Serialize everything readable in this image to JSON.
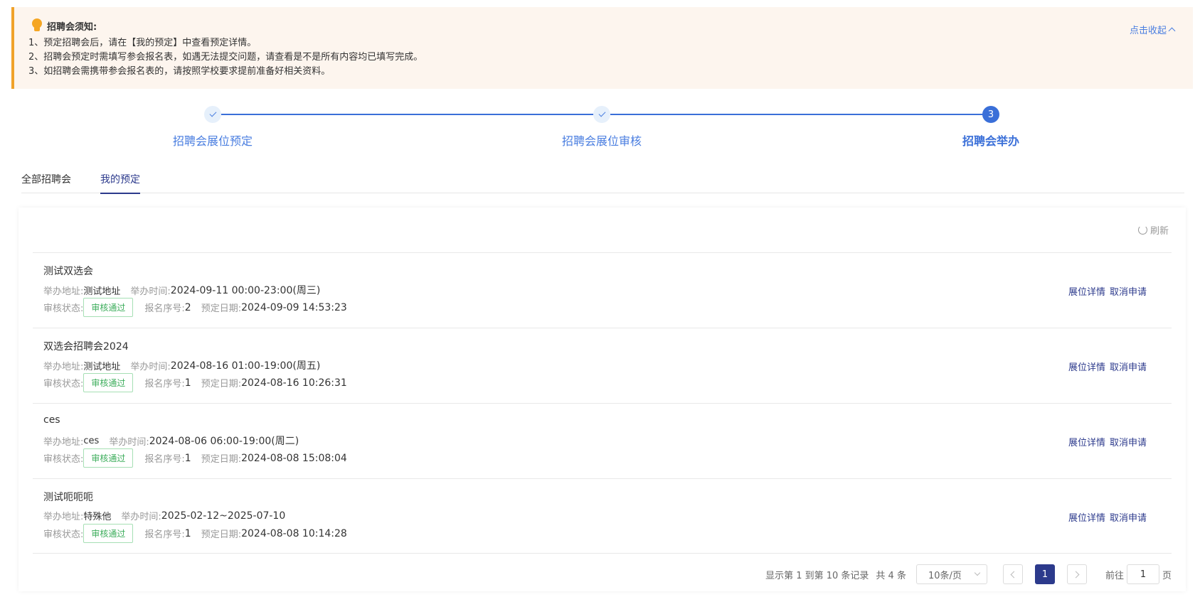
{
  "notice": {
    "title": "招聘会须知:",
    "lines": [
      "1、预定招聘会后，请在【我的预定】中查看预定详情。",
      "2、招聘会预定时需填写参会报名表，如遇无法提交问题，请查看是不是所有内容均已填写完成。",
      "3、如招聘会需携带参会报名表的，请按照学校要求提前准备好相关资料。"
    ],
    "collapse_label": "点击收起"
  },
  "steps": [
    {
      "label": "招聘会展位预定",
      "status": "done"
    },
    {
      "label": "招聘会展位审核",
      "status": "done"
    },
    {
      "label": "招聘会举办",
      "status": "active",
      "number": "3"
    }
  ],
  "tabs": [
    {
      "label": "全部招聘会",
      "active": false
    },
    {
      "label": "我的预定",
      "active": true
    }
  ],
  "refresh_label": "刷新",
  "labels": {
    "address": "举办地址:",
    "time": "举办时间:",
    "status": "审核状态:",
    "serial": "报名序号:",
    "booked": "预定日期:"
  },
  "items": [
    {
      "title": "测试双选会",
      "address": "测试地址",
      "time": "2024-09-11 00:00-23:00(周三)",
      "status": "审核通过",
      "serial": "2",
      "booked": "2024-09-09 14:53:23",
      "detail": "展位详情",
      "cancel": "取消申请"
    },
    {
      "title": "双选会招聘会2024",
      "address": "测试地址",
      "time": "2024-08-16 01:00-19:00(周五)",
      "status": "审核通过",
      "serial": "1",
      "booked": "2024-08-16 10:26:31",
      "detail": "展位详情",
      "cancel": "取消申请"
    },
    {
      "title": "ces",
      "address": "ces",
      "time": "2024-08-06 06:00-19:00(周二)",
      "status": "审核通过",
      "serial": "1",
      "booked": "2024-08-08 15:08:04",
      "detail": "展位详情",
      "cancel": "取消申请"
    },
    {
      "title": "测试呃呃呃",
      "address": "特殊他",
      "time": "2025-02-12~2025-07-10",
      "status": "审核通过",
      "serial": "1",
      "booked": "2024-08-08 10:14:28",
      "detail": "展位详情",
      "cancel": "取消申请"
    }
  ],
  "pagination": {
    "info": "显示第 1 到第 10 条记录",
    "total": "共 4 条",
    "page_size": "10条/页",
    "current_page": "1",
    "goto_prefix": "前往",
    "goto_value": "1",
    "goto_suffix": "页"
  },
  "colors": {
    "accent": "#2c3a8c",
    "step_blue": "#3a6fd8",
    "notice_bg": "#fdf5ee",
    "notice_border": "#f0a22a",
    "success": "#3cad5b"
  }
}
